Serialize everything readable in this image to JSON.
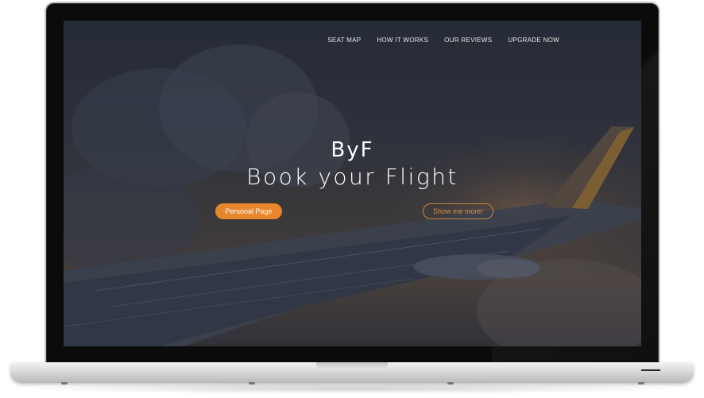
{
  "nav": {
    "items": [
      {
        "label": "SEAT MAP"
      },
      {
        "label": "HOW IT WORKS"
      },
      {
        "label": "OUR REVIEWS"
      },
      {
        "label": "UPGRADE NOW"
      }
    ]
  },
  "hero": {
    "logo": "ByF",
    "title": "Book your Flight",
    "primary_button": "Personal Page",
    "secondary_button": "Show me more!"
  },
  "colors": {
    "accent": "#e8862c",
    "outline_accent": "#c6843e",
    "bezel": "#0b0b0b"
  }
}
